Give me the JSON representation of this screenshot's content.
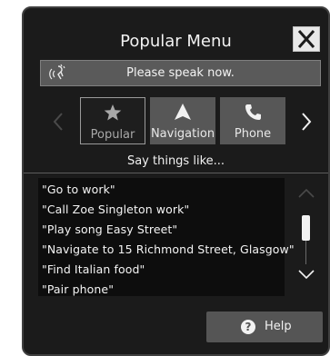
{
  "window": {
    "title": "Popular Menu"
  },
  "speak_bar": {
    "text": "Please speak now."
  },
  "tabs": [
    {
      "label": "Popular",
      "icon": "star-icon",
      "selected": true
    },
    {
      "label": "Navigation",
      "icon": "navigation-arrow-icon",
      "selected": false
    },
    {
      "label": "Phone",
      "icon": "phone-icon",
      "selected": false
    }
  ],
  "hint": "Say things like...",
  "commands": [
    "\"Go to work\"",
    "\"Call Zoe Singleton work\"",
    "\"Play song Easy Street\"",
    "\"Navigate to 15 Richmond Street, Glasgow\"",
    "\"Find Italian food\"",
    "\"Pair phone\""
  ],
  "help_button": {
    "label": "Help"
  },
  "colors": {
    "panel_bg": "#1b1b1b",
    "button_bg": "#575757",
    "speak_bar_bg": "#5a5a5a",
    "text": "#f2f2f2"
  }
}
